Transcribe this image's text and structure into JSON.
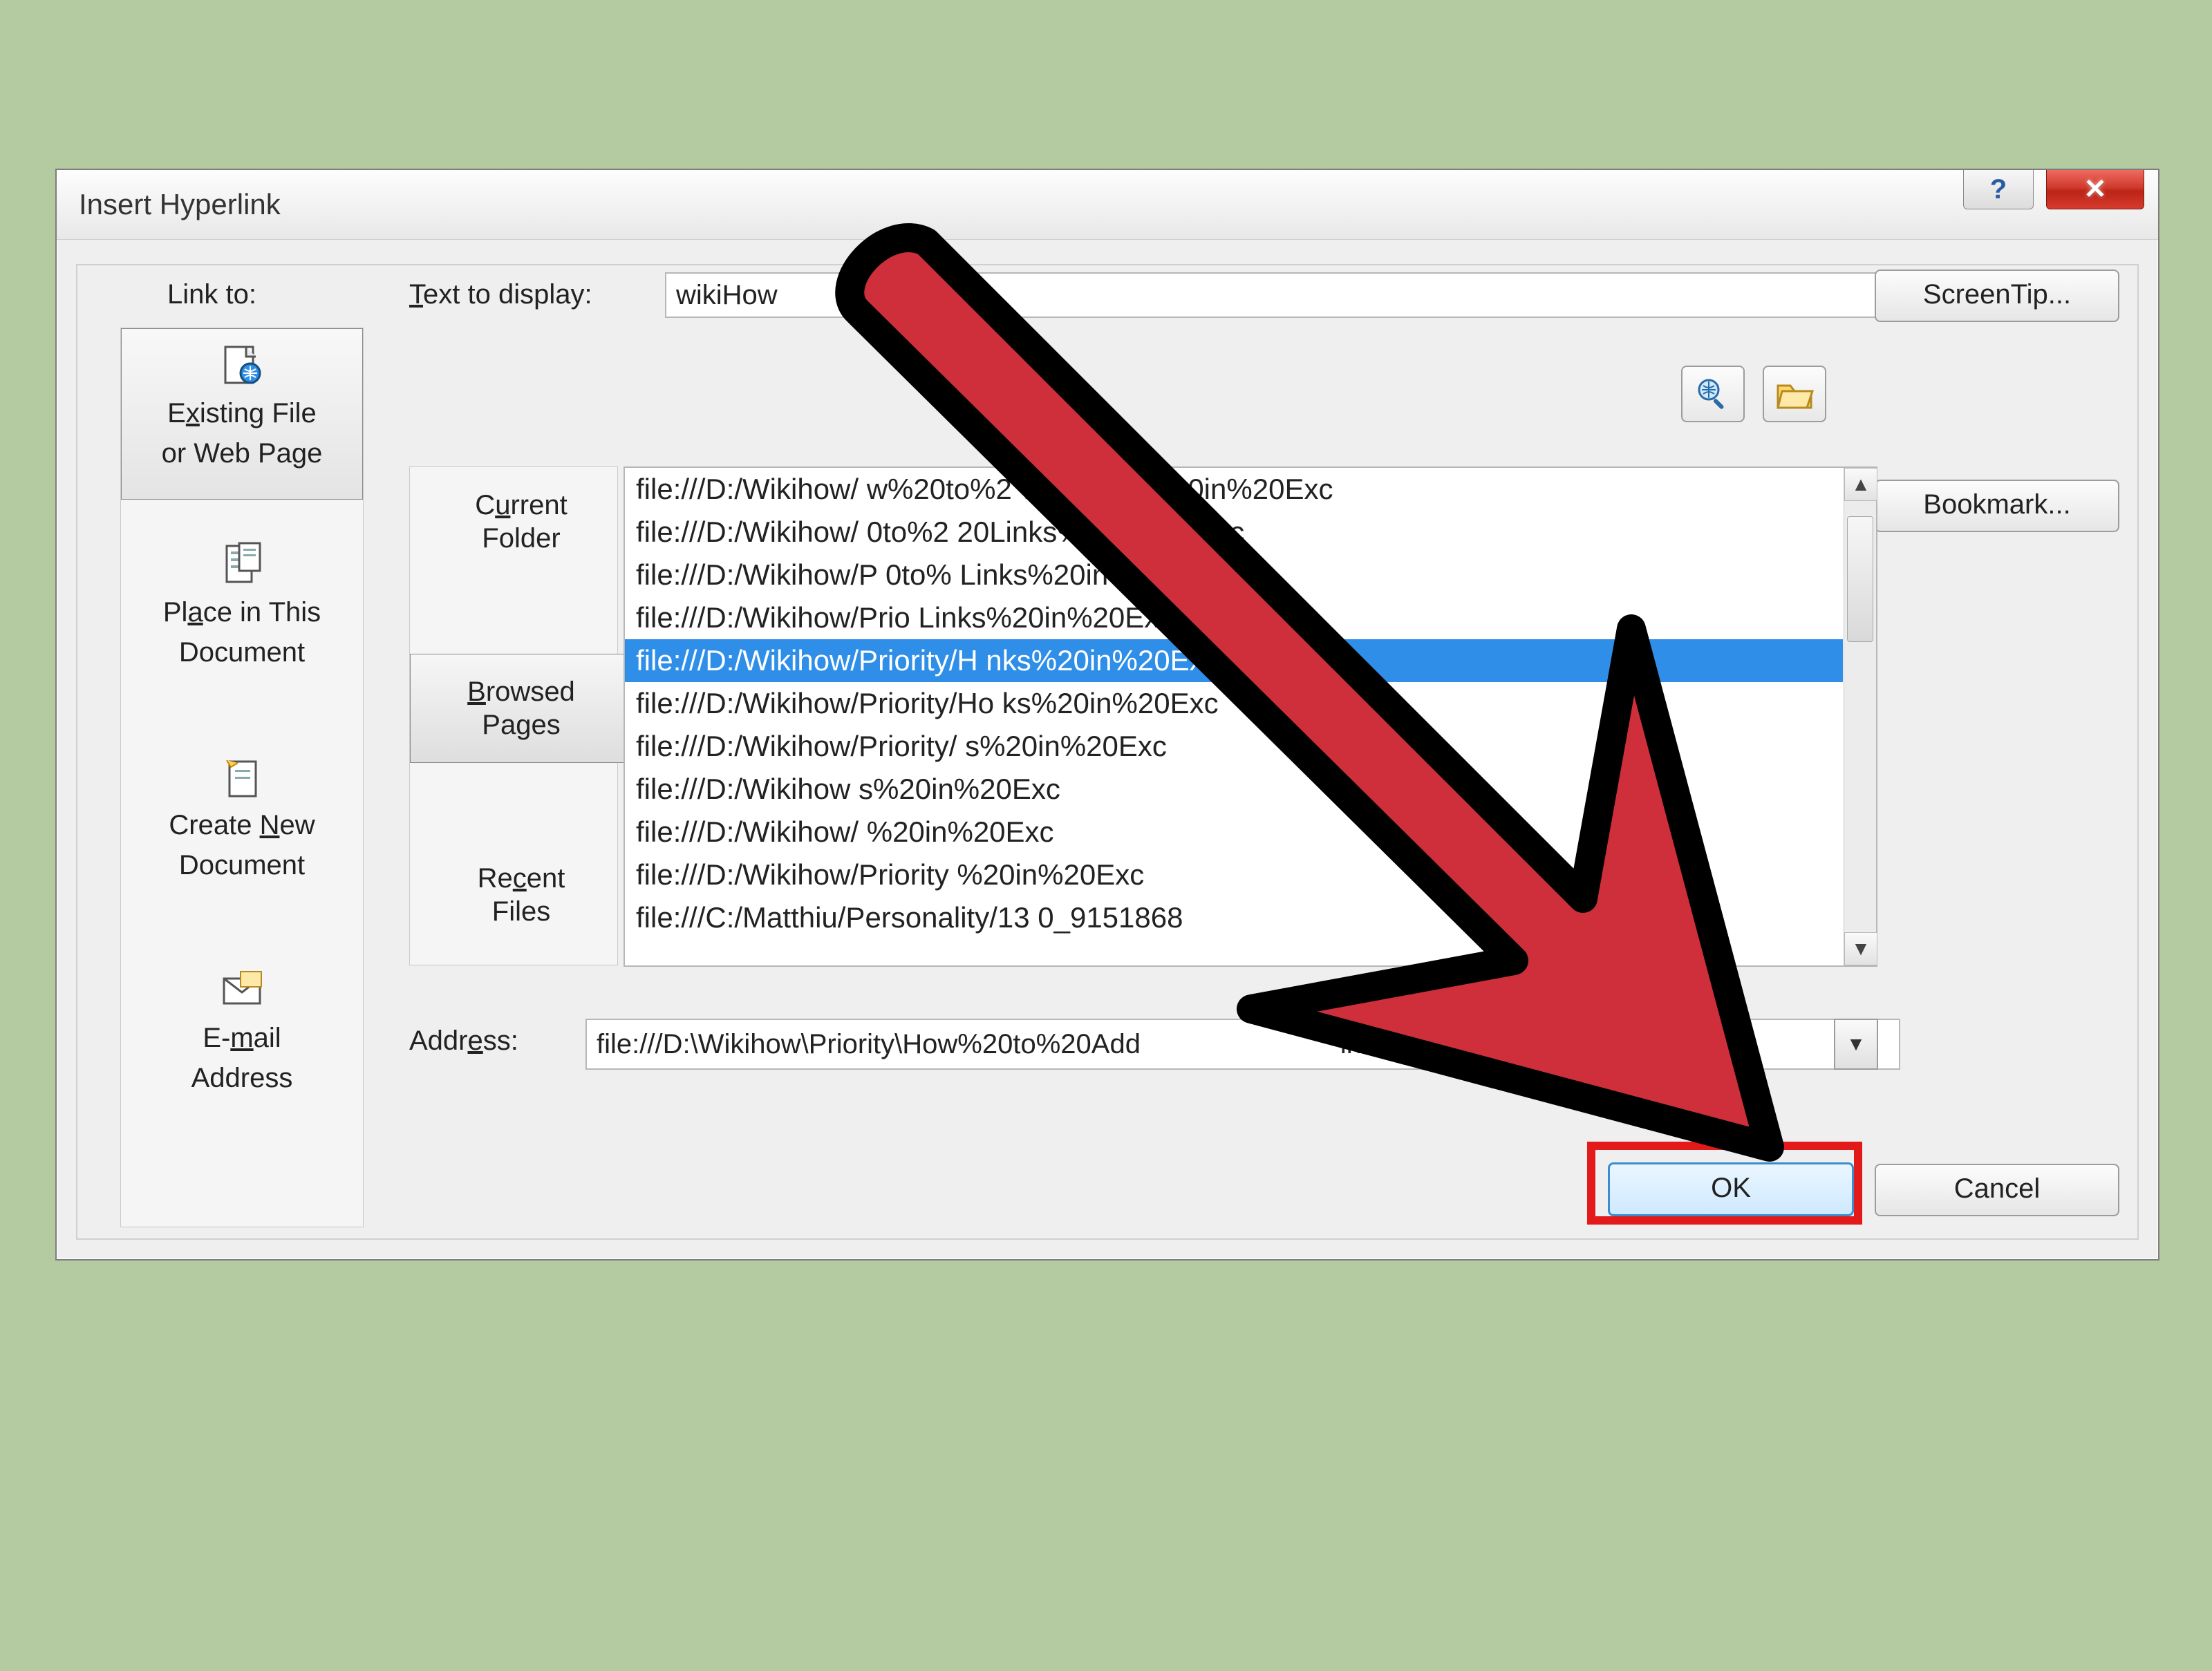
{
  "dialog": {
    "title": "Insert Hyperlink",
    "link_to_label": "Link to:",
    "text_to_display_label_pre": "T",
    "text_to_display_label_post": "ext to display:",
    "text_to_display_value": "wikiHow",
    "screentip_label": "ScreenTip...",
    "bookmark_label": "Bookmark...",
    "address_label_pre": "Addr",
    "address_label_ul": "e",
    "address_label_post": "ss:",
    "address_value": "file:///D:\\Wikihow\\Priority\\How%20to%20Add                          in%20Exc",
    "ok_label": "OK",
    "cancel_label": "Cancel"
  },
  "left_items": [
    {
      "l1_pre": "E",
      "l1_ul": "x",
      "l1_post": "isting File",
      "l2": "or Web Page",
      "active": true
    },
    {
      "l1": "Pl",
      "l1_ul": "a",
      "l1_post": "ce in This",
      "l2": "Document",
      "active": false
    },
    {
      "l1": "Create ",
      "l1_ul": "N",
      "l1_post": "ew",
      "l2": "Document",
      "active": false
    },
    {
      "l1": "E-",
      "l1_ul": "m",
      "l1_post": "ail",
      "l2": "Address",
      "active": false
    }
  ],
  "mid_tabs": {
    "current": {
      "l1": "C",
      "l1_ul": "u",
      "l1_post": "rrent",
      "l2": "Folder"
    },
    "browsed": {
      "l1_ul": "B",
      "l1_post": "rowsed",
      "l2": "Pages"
    },
    "recent": {
      "l1": "Re",
      "l1_ul": "c",
      "l1_post": "ent",
      "l2": "Files"
    }
  },
  "file_list": [
    "file:///D:/Wikihow/                       w%20to%2            %20Links%20in%20Exc",
    "file:///D:/Wikihow/                         0to%2                 20Links%20in%20Exc",
    "file:///D:/Wikihow/P                           0to%                    Links%20in%20Exc",
    "file:///D:/Wikihow/Prio                                                    Links%20in%20Exc",
    "file:///D:/Wikihow/Priority/H                                            nks%20in%20Ex",
    "file:///D:/Wikihow/Priority/Ho                                          ks%20in%20Exc",
    "file:///D:/Wikihow/Priority/                                              s%20in%20Exc",
    "file:///D:/Wikihow                                                             s%20in%20Exc",
    "file:///D:/Wikihow/                                                           %20in%20Exc",
    "file:///D:/Wikihow/Priority                                                %20in%20Exc",
    "file:///C:/Matthiu/Personality/13                                     0_9151868"
  ],
  "selected_index": 4
}
